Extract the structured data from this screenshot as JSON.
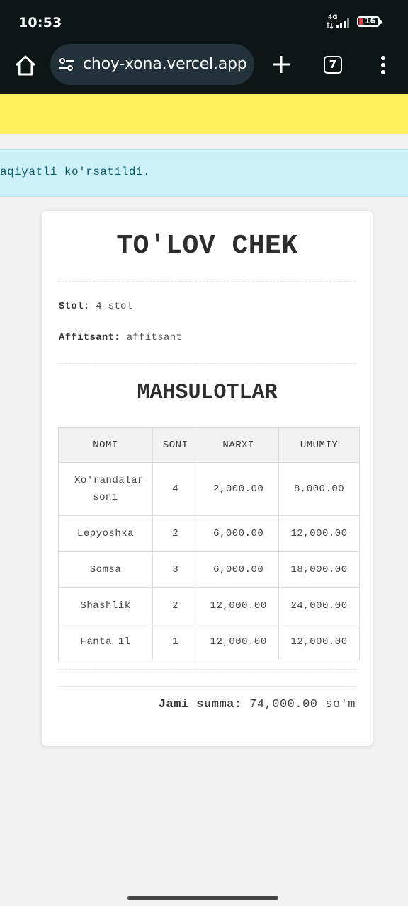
{
  "status_bar": {
    "time": "10:53",
    "network": "4G",
    "battery": "16"
  },
  "browser": {
    "url": "choy-xona.vercel.app",
    "tab_count": "7"
  },
  "alert": {
    "text": "aqiyatli ko'rsatildi."
  },
  "receipt": {
    "title": "TO'LOV CHEK",
    "table_label": "Stol:",
    "table_value": "4-stol",
    "waiter_label": "Affitsant:",
    "waiter_value": "affitsant",
    "products_title": "MAHSULOTLAR",
    "columns": [
      "NOMI",
      "SONI",
      "NARXI",
      "UMUMIY"
    ],
    "rows": [
      {
        "name": "Xo'randalar soni",
        "qty": "4",
        "price": "2,000.00",
        "total": "8,000.00"
      },
      {
        "name": "Lepyoshka",
        "qty": "2",
        "price": "6,000.00",
        "total": "12,000.00"
      },
      {
        "name": "Somsa",
        "qty": "3",
        "price": "6,000.00",
        "total": "18,000.00"
      },
      {
        "name": "Shashlik",
        "qty": "2",
        "price": "12,000.00",
        "total": "24,000.00"
      },
      {
        "name": "Fanta 1l",
        "qty": "1",
        "price": "12,000.00",
        "total": "12,000.00"
      }
    ],
    "total_label": "Jami summa:",
    "total_value": "74,000.00 so'm"
  }
}
